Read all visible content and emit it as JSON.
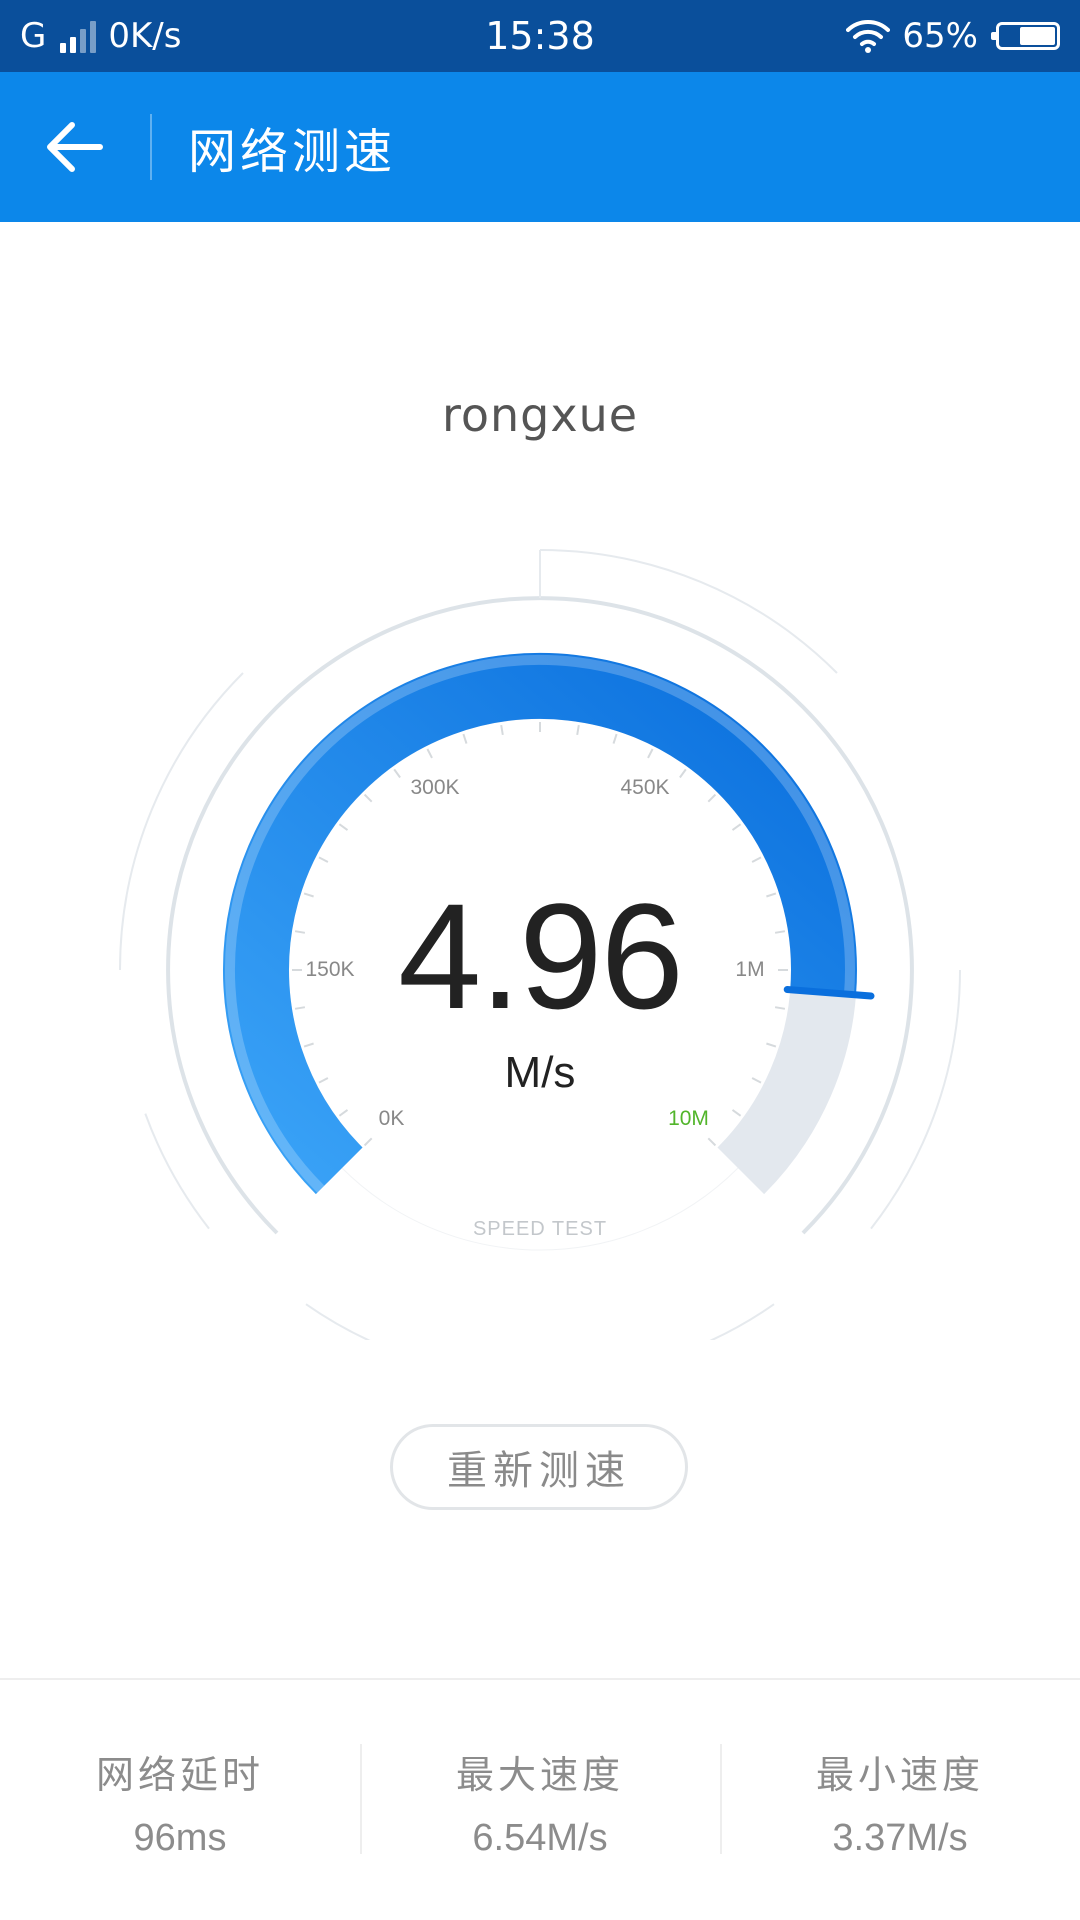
{
  "status_bar": {
    "network_type": "G",
    "data_rate": "0K/s",
    "time": "15:38",
    "battery_percent": "65%",
    "battery_level": 0.65,
    "icons": [
      "signal-icon",
      "wifi-icon",
      "battery-icon"
    ]
  },
  "app_bar": {
    "back_icon": "arrow-left-icon",
    "title": "网络测速"
  },
  "network": {
    "name": "rongxue"
  },
  "gauge": {
    "speed_value": "4.96",
    "speed_unit": "M/s",
    "tick_labels": [
      "0K",
      "150K",
      "300K",
      "450K",
      "1M",
      "10M"
    ],
    "caption": "SPEED TEST",
    "progress_fraction": 0.85,
    "colors": {
      "arc_light": "#3aa3f7",
      "arc_dark": "#0a6fdd",
      "track": "#e3e8ee",
      "accent_label": "#52b52b"
    }
  },
  "actions": {
    "retest_label": "重新测速"
  },
  "stats": [
    {
      "label": "网络延时",
      "value": "96ms"
    },
    {
      "label": "最大速度",
      "value": "6.54M/s"
    },
    {
      "label": "最小速度",
      "value": "3.37M/s"
    }
  ]
}
